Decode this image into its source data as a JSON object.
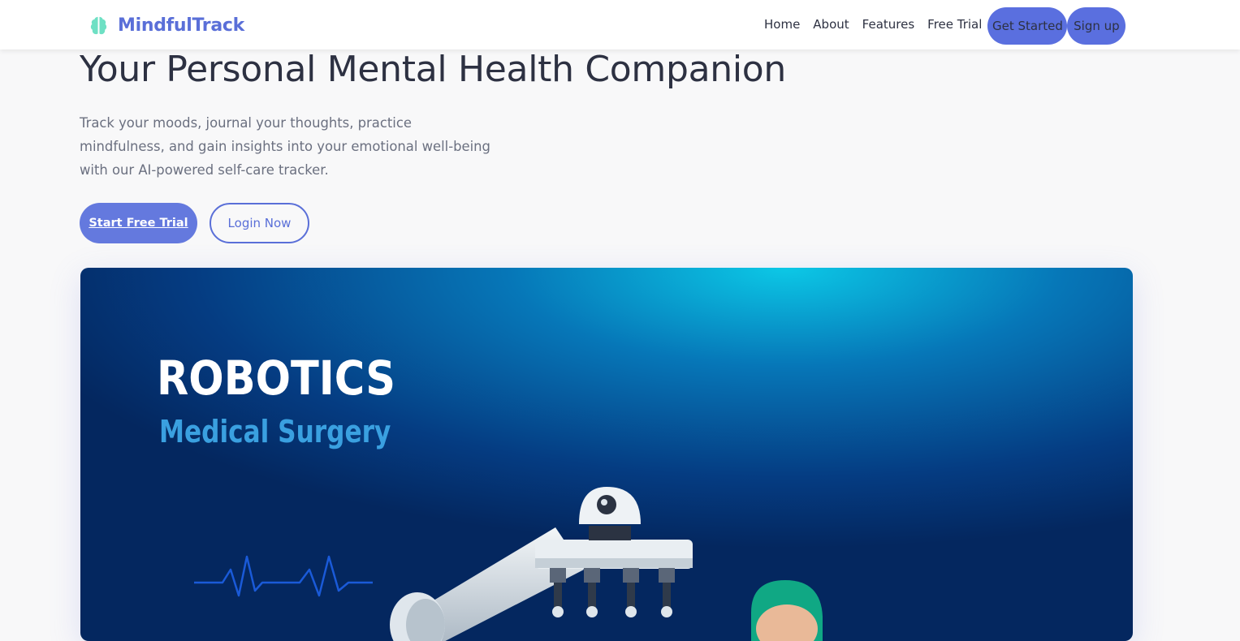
{
  "brand": {
    "name": "MindfulTrack",
    "icon": "brain-icon",
    "color": "#5a6fd8"
  },
  "nav": {
    "links": [
      "Home",
      "About",
      "Features",
      "Free Trial"
    ],
    "get_started": "Get Started",
    "signup": "Sign up"
  },
  "hero": {
    "title": "Your Personal Mental Health Companion",
    "subtitle": "Track your moods, journal your thoughts, practice mindfulness, and gain insights into your emotional well-being with our AI-powered self-care tracker.",
    "primary_cta": "Start Free Trial",
    "secondary_cta": "Login Now"
  },
  "hero_image": {
    "title": "ROBOTICS",
    "subtitle": "Medical Surgery"
  },
  "colors": {
    "accent": "#5a6fdf",
    "background": "#f8f8f9",
    "text": "#2d3142",
    "muted": "#6b7080"
  }
}
